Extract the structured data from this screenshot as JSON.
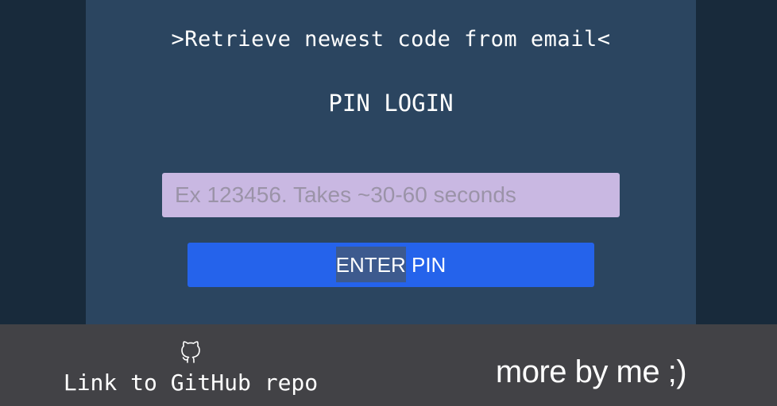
{
  "login": {
    "subtitle": ">Retrieve newest code from email<",
    "title": "PIN LOGIN",
    "pin_input": {
      "value": "",
      "placeholder": "Ex 123456. Takes ~30-60 seconds"
    },
    "enter_button": {
      "label_highlighted": "ENTER",
      "label_rest": " PIN"
    }
  },
  "footer": {
    "github_icon": "github-icon",
    "github_link_label": "Link to GitHub repo",
    "more_link_label": "more by me ;)"
  },
  "colors": {
    "background": "#182a3b",
    "panel": "#2b4560",
    "input_background": "#c9b8e2",
    "button": "#2563eb",
    "footer": "#424246"
  }
}
